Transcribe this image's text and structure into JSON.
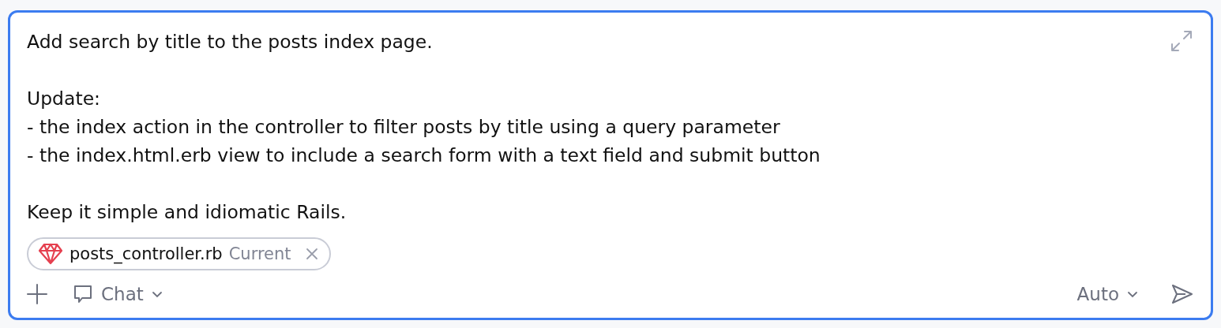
{
  "prompt": {
    "paragraphs": [
      {
        "lines": [
          "Add search by title to the posts index page."
        ]
      },
      {
        "lines": [
          "Update:",
          "- the index action in the controller to filter posts by title using a query parameter",
          "- the index.html.erb view to include a search form with a text field and submit button"
        ]
      },
      {
        "lines": [
          "Keep it simple and idiomatic Rails."
        ]
      }
    ]
  },
  "attachments": [
    {
      "file": "posts_controller.rb",
      "tag": "Current"
    }
  ],
  "mode": {
    "label": "Chat"
  },
  "model": {
    "label": "Auto"
  }
}
